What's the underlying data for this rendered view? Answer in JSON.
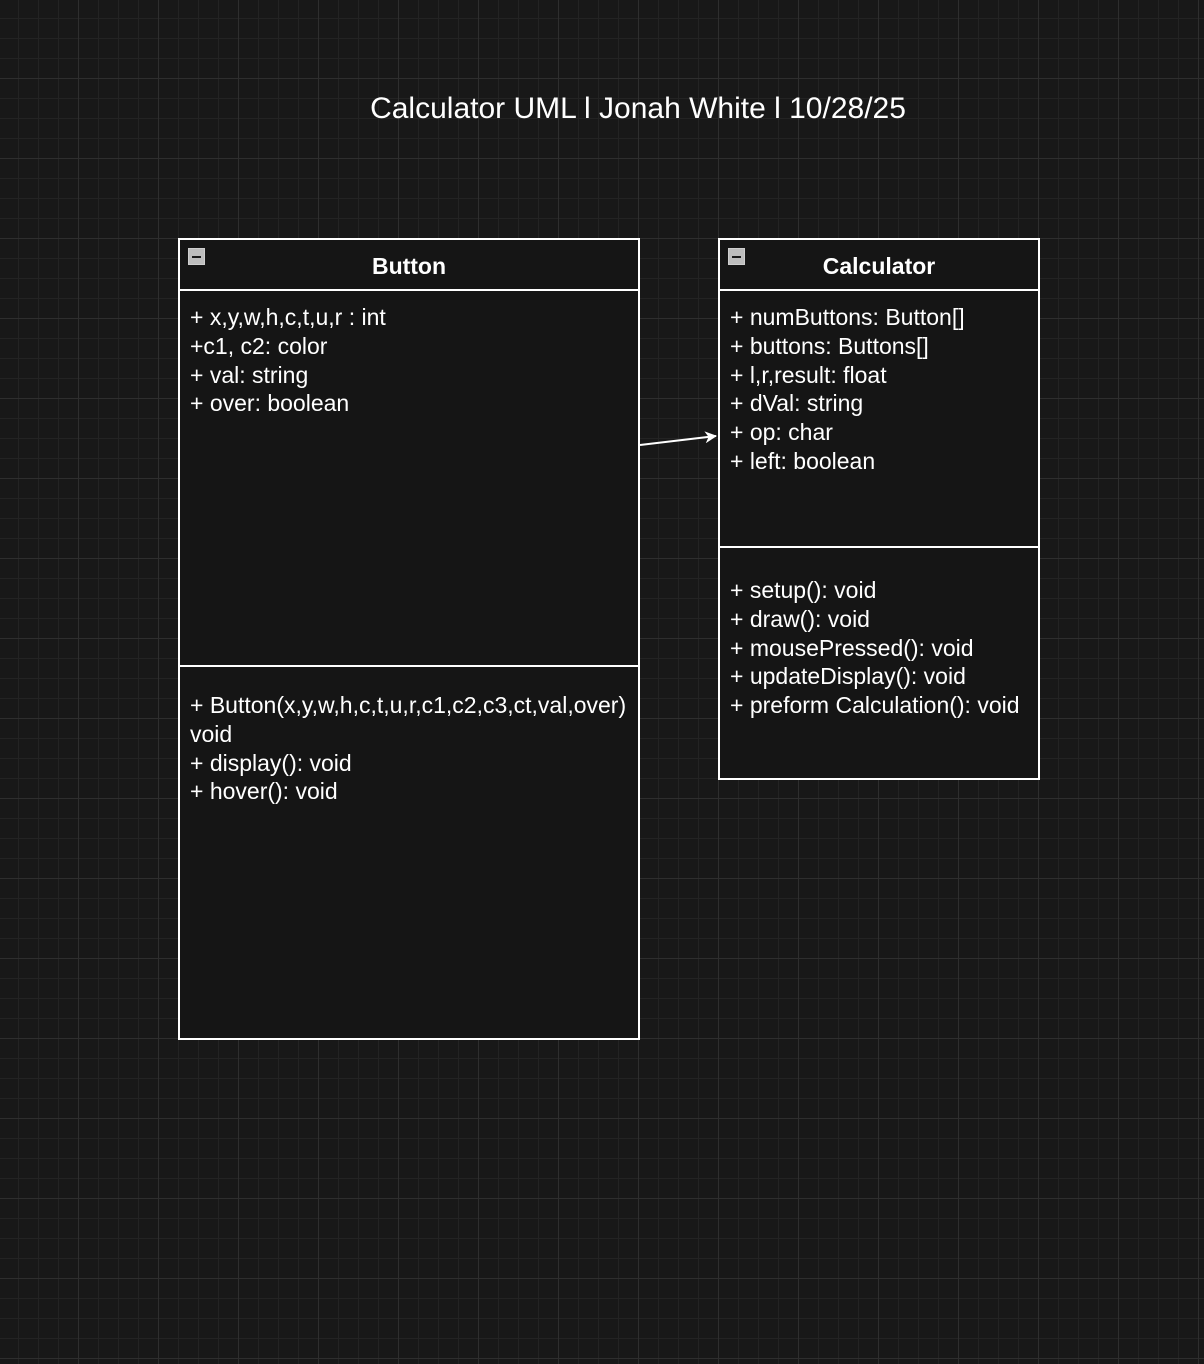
{
  "title": "Calculator UML l Jonah White l 10/28/25",
  "classes": {
    "button": {
      "name": "Button",
      "attributes": [
        "+ x,y,w,h,c,t,u,r : int",
        "+c1, c2: color",
        "+ val: string",
        "+ over: boolean"
      ],
      "operations": [
        "+ Button(x,y,w,h,c,t,u,r,c1,c2,c3,ct,val,over) void",
        "+ display(): void",
        "+ hover(): void"
      ]
    },
    "calculator": {
      "name": "Calculator",
      "attributes": [
        "+ numButtons: Button[]",
        "+ buttons: Buttons[]",
        "+ l,r,result: float",
        "+ dVal: string",
        "+ op: char",
        "+ left: boolean"
      ],
      "operations": [
        "+ setup(): void",
        "+ draw(): void",
        "+ mousePressed(): void",
        "+ updateDisplay(): void",
        "+ preform Calculation(): void"
      ]
    }
  },
  "relationships": [
    {
      "from": "Button",
      "to": "Calculator",
      "type": "directed-association"
    }
  ],
  "colors": {
    "background": "#181818",
    "stroke": "#ffffff",
    "text": "#ffffff"
  }
}
